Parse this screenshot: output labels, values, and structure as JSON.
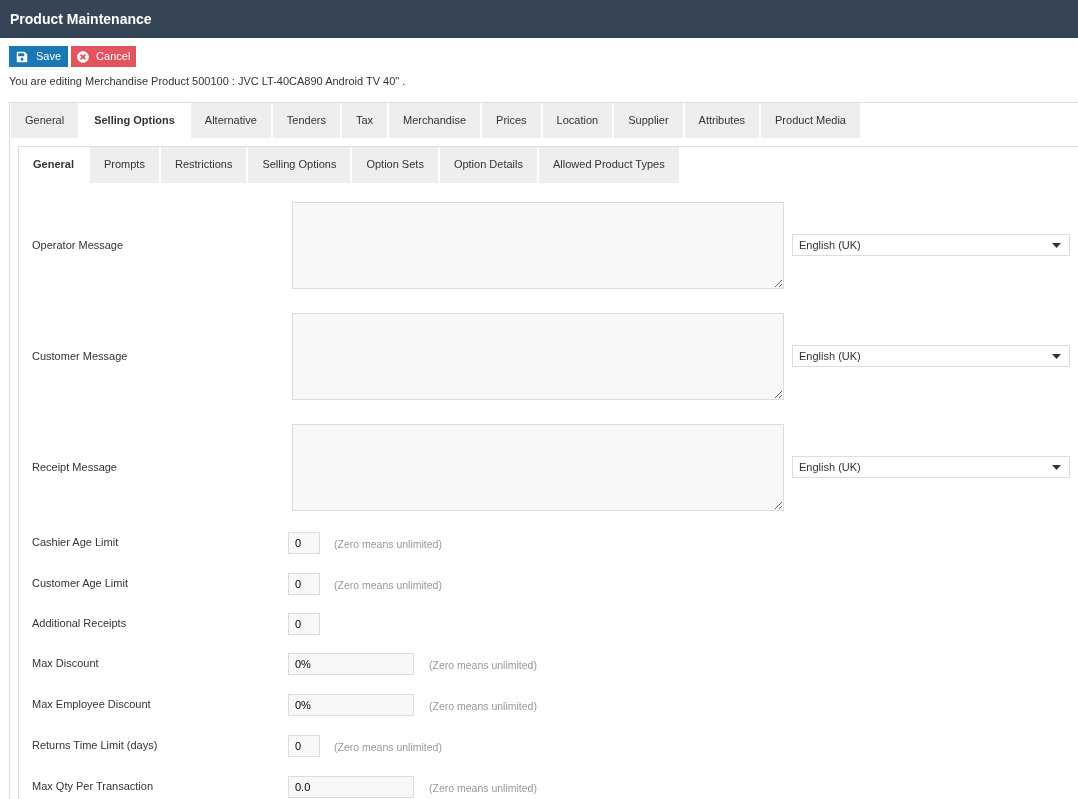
{
  "header": {
    "title": "Product Maintenance"
  },
  "toolbar": {
    "buttons": [
      {
        "kind": "save",
        "label": "Save"
      },
      {
        "kind": "cancel",
        "label": "Cancel"
      }
    ]
  },
  "editing_notice": "You are editing Merchandise Product 500100 : JVC LT-40CA890 Android TV 40\" .",
  "tabs": [
    {
      "label": "General",
      "selected": false
    },
    {
      "label": "Selling Options",
      "selected": true
    },
    {
      "label": "Alternative",
      "selected": false
    },
    {
      "label": "Tenders",
      "selected": false
    },
    {
      "label": "Tax",
      "selected": false
    },
    {
      "label": "Merchandise",
      "selected": false
    },
    {
      "label": "Prices",
      "selected": false
    },
    {
      "label": "Location",
      "selected": false
    },
    {
      "label": "Supplier",
      "selected": false
    },
    {
      "label": "Attributes",
      "selected": false
    },
    {
      "label": "Product Media",
      "selected": false
    }
  ],
  "subtabs": [
    {
      "label": "General",
      "selected": true
    },
    {
      "label": "Prompts",
      "selected": false
    },
    {
      "label": "Restrictions",
      "selected": false
    },
    {
      "label": "Selling Options",
      "selected": false
    },
    {
      "label": "Option Sets",
      "selected": false
    },
    {
      "label": "Option Details",
      "selected": false
    },
    {
      "label": "Allowed Product Types",
      "selected": false
    }
  ],
  "form": {
    "rows": [
      {
        "kind": "message",
        "label": "Operator Message",
        "language": "English (UK)"
      },
      {
        "kind": "message",
        "label": "Customer Message",
        "language": "English (UK)"
      },
      {
        "kind": "message",
        "label": "Receipt Message",
        "language": "English (UK)"
      },
      {
        "kind": "short",
        "label": "Cashier Age Limit",
        "value": "0",
        "hint": "(Zero means unlimited)"
      },
      {
        "kind": "short",
        "label": "Customer Age Limit",
        "value": "0",
        "hint": "(Zero means unlimited)"
      },
      {
        "kind": "short",
        "label": "Additional Receipts",
        "value": "0"
      },
      {
        "kind": "wide",
        "label": "Max Discount",
        "value": "0%",
        "hint": "(Zero means unlimited)"
      },
      {
        "kind": "wide",
        "label": "Max Employee Discount",
        "value": "0%",
        "hint": "(Zero means unlimited)"
      },
      {
        "kind": "short",
        "label": "Returns Time Limit (days)",
        "value": "0",
        "hint": "(Zero means unlimited)"
      },
      {
        "kind": "wide",
        "label": "Max Qty Per Transaction",
        "value": "0.0",
        "hint": "(Zero means unlimited)"
      }
    ]
  }
}
